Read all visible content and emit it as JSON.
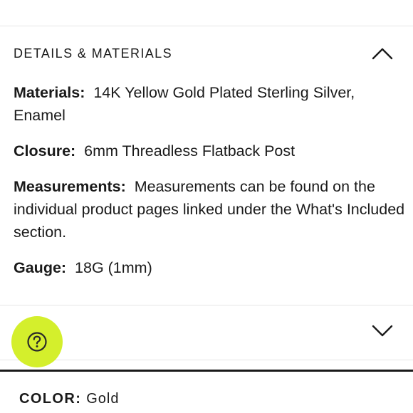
{
  "details_accordion": {
    "title": "DETAILS & MATERIALS",
    "expanded": true,
    "toggle_icon": "chevron-up-icon",
    "items": [
      {
        "label": "Materials:",
        "value": "14K Yellow Gold Plated Sterling Silver, Enamel"
      },
      {
        "label": "Closure:",
        "value": "6mm Threadless Flatback Post"
      },
      {
        "label": "Measurements:",
        "value": "Measurements can be found on the individual product pages linked under the What's Included section."
      },
      {
        "label": "Gauge:",
        "value": "18G (1mm)"
      }
    ]
  },
  "second_accordion": {
    "expanded": false,
    "toggle_icon": "chevron-down-icon"
  },
  "help_button": {
    "icon": "question-circle-icon",
    "color": "#d4ef2c"
  },
  "color_selector": {
    "label": "COLOR:",
    "value": "Gold"
  }
}
